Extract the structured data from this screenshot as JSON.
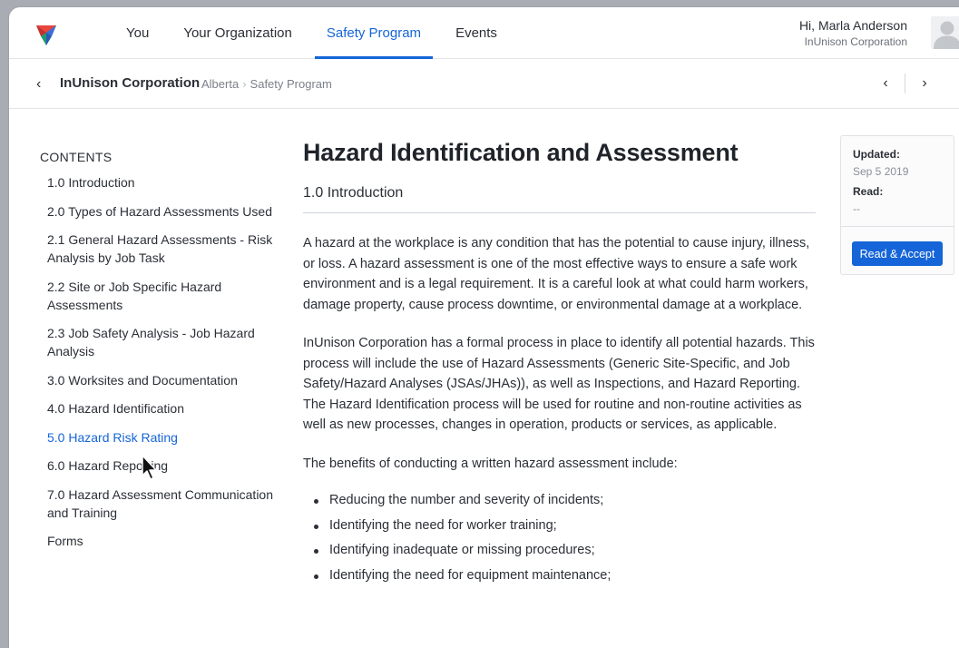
{
  "nav": {
    "tabs": [
      {
        "label": "You"
      },
      {
        "label": "Your Organization"
      },
      {
        "label": "Safety Program"
      },
      {
        "label": "Events"
      }
    ],
    "user_greeting": "Hi, Marla Anderson",
    "user_org": "InUnison Corporation"
  },
  "breadcrumb": {
    "back_icon": "‹",
    "org": "InUnison Corporation",
    "path": [
      "Alberta",
      "Safety Program"
    ],
    "separator": "›",
    "prev_icon": "‹",
    "next_icon": "›"
  },
  "toc": {
    "title": "CONTENTS",
    "items": [
      {
        "label": "1.0 Introduction"
      },
      {
        "label": "2.0 Types of Hazard Assessments Used"
      },
      {
        "label": "2.1 General Hazard Assessments - Risk Analysis by Job Task"
      },
      {
        "label": "2.2 Site or Job Specific Hazard Assessments"
      },
      {
        "label": "2.3 Job Safety Analysis - Job Hazard Analysis"
      },
      {
        "label": "3.0 Worksites and Documentation"
      },
      {
        "label": "4.0 Hazard Identification"
      },
      {
        "label": "5.0 Hazard Risk Rating"
      },
      {
        "label": "6.0 Hazard Reporting"
      },
      {
        "label": "7.0 Hazard Assessment Communication and Training"
      },
      {
        "label": "Forms"
      }
    ]
  },
  "content": {
    "title": "Hazard Identification and Assessment",
    "section_heading": "1.0 Introduction",
    "paragraphs": [
      "A hazard at the workplace is any condition that has the potential to cause injury, illness, or loss. A hazard assessment is one of the most effective ways to ensure a safe work environment and is a legal requirement. It is a careful look at what could harm workers, damage property, cause process downtime, or environmental damage at a workplace.",
      "InUnison Corporation has a formal process in place to identify all potential hazards. This process will include the use of Hazard Assessments (Generic Site-Specific, and Job Safety/Hazard Analyses (JSAs/JHAs)), as well as Inspections, and Hazard Reporting. The Hazard Identification process will be used for routine and non-routine activities as well as new processes, changes in operation, products or services, as applicable.",
      "The benefits of conducting a written hazard assessment include:"
    ],
    "bullets": [
      "Reducing the number and severity of incidents;",
      "Identifying the need for worker training;",
      "Identifying inadequate or missing procedures;",
      "Identifying the need for equipment maintenance;"
    ]
  },
  "card": {
    "updated_label": "Updated:",
    "updated_value": "Sep 5 2019",
    "read_label": "Read:",
    "read_value": "--",
    "button_label": "Read & Accept"
  },
  "colors": {
    "accent": "#1565d8"
  }
}
